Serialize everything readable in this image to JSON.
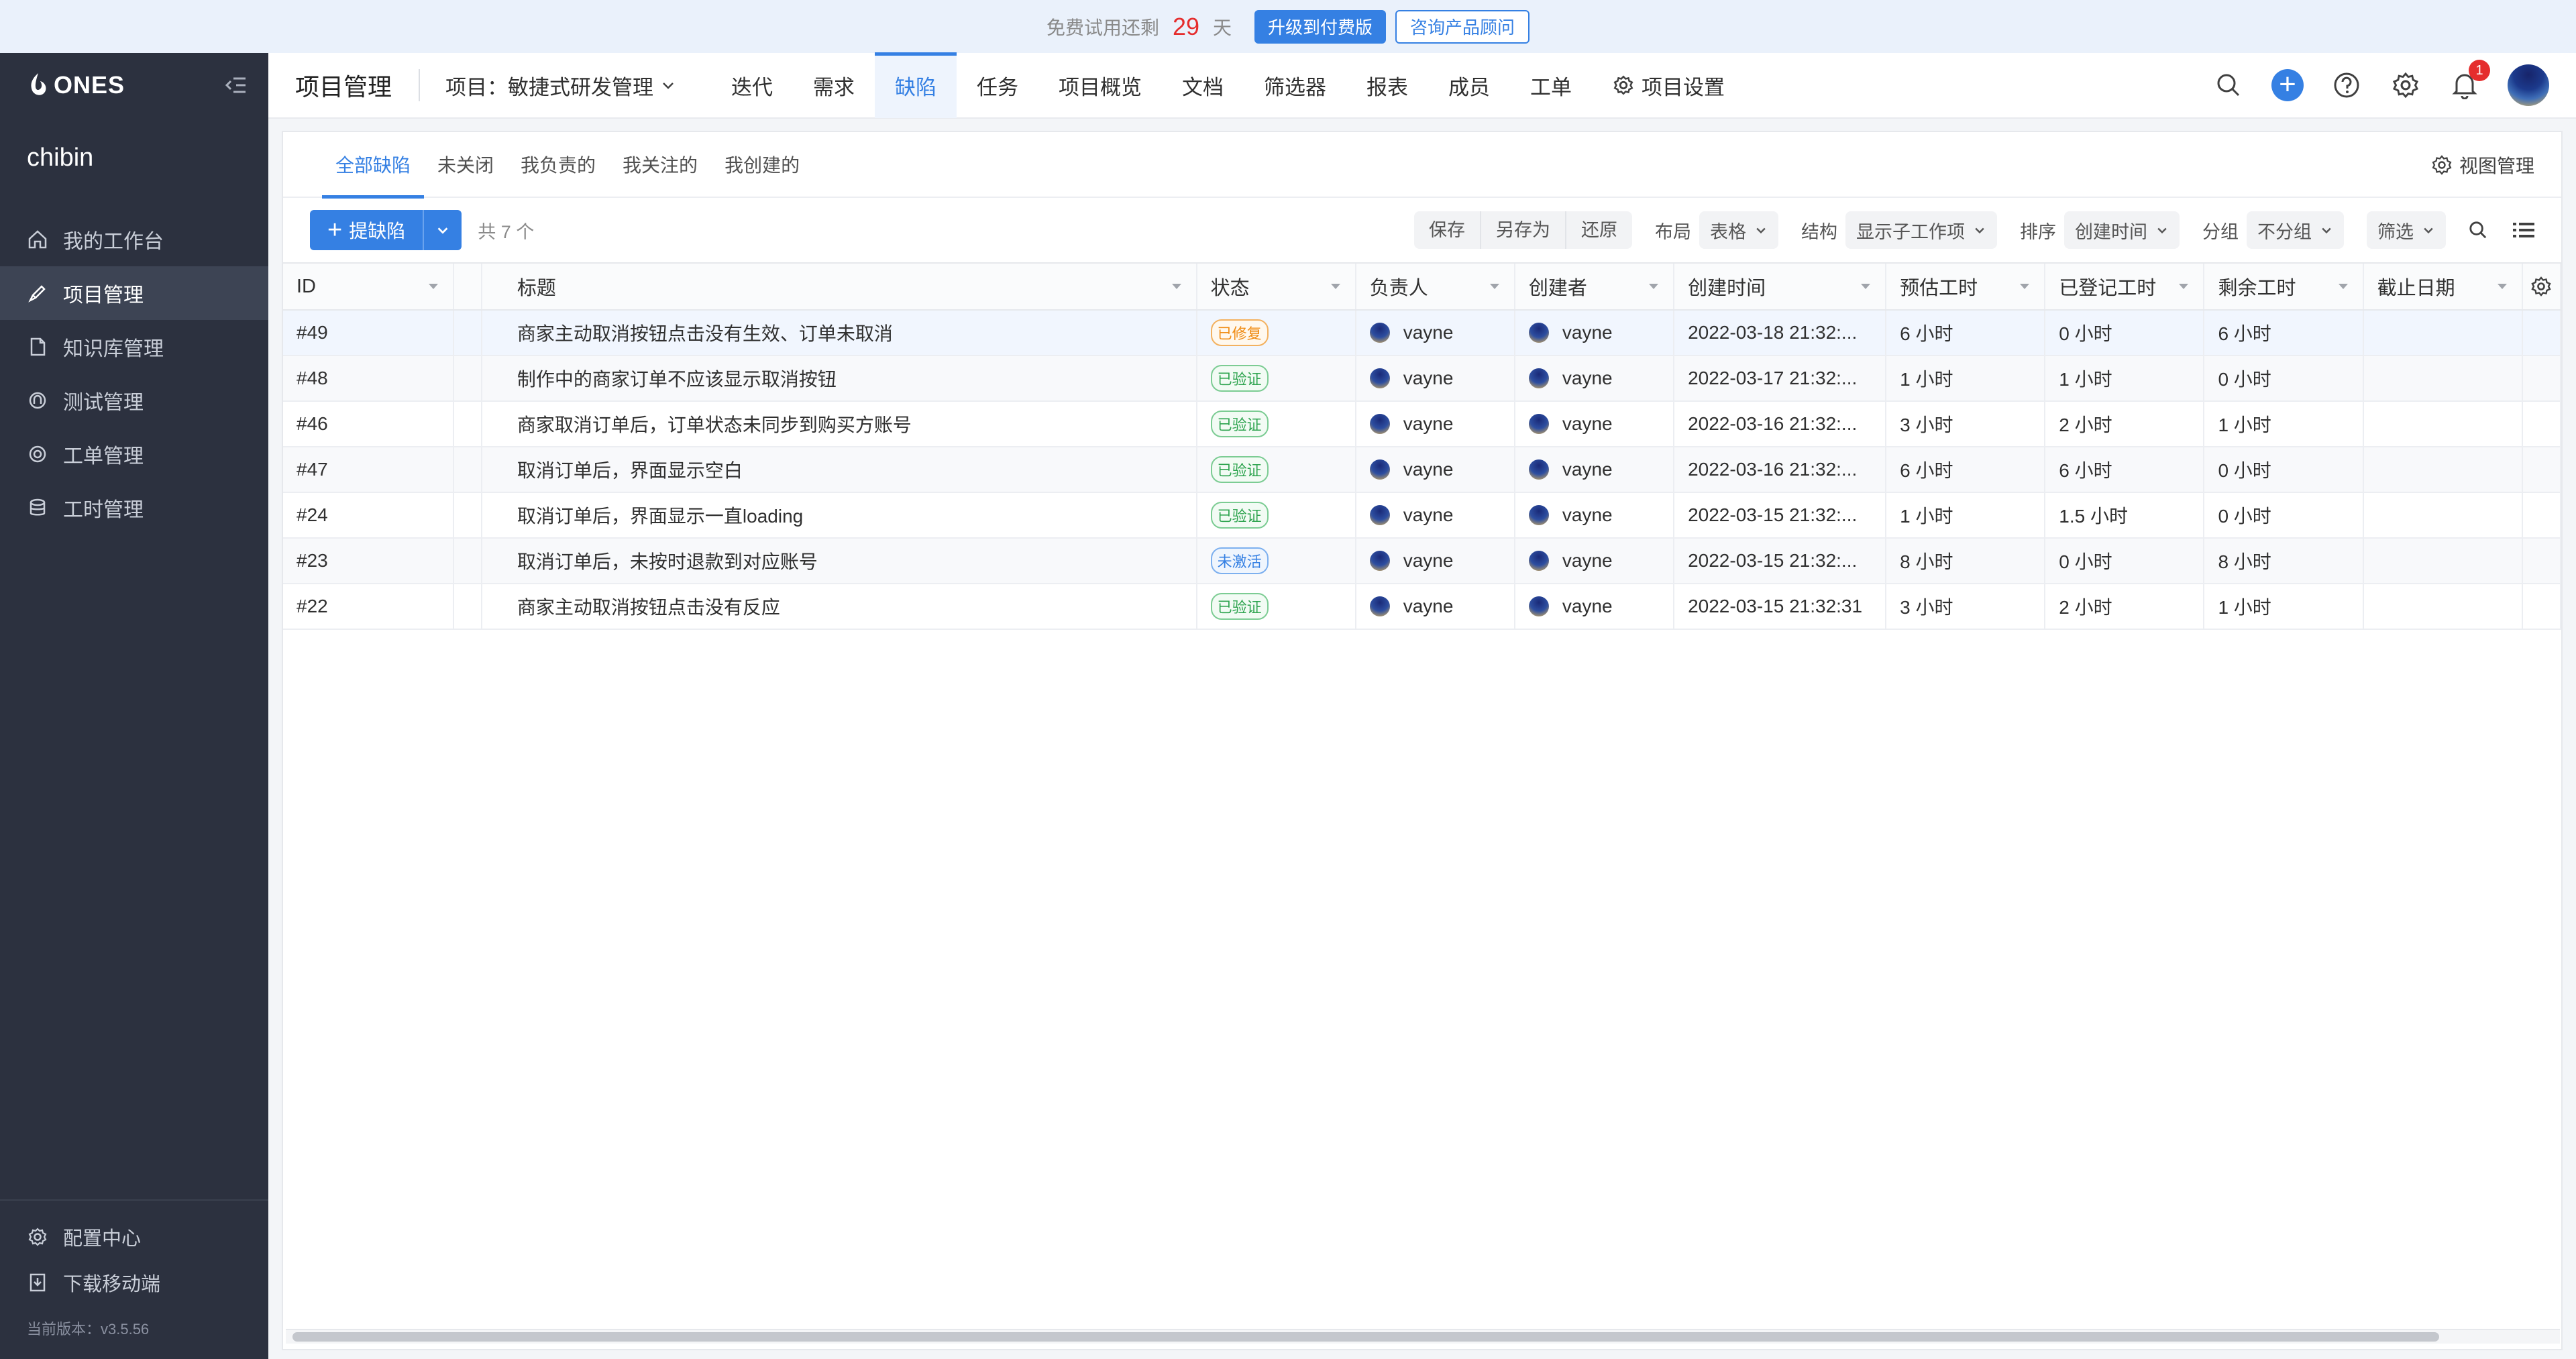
{
  "banner": {
    "prefix": "免费试用还剩",
    "days": "29",
    "suffix": "天",
    "upgrade_label": "升级到付费版",
    "consult_label": "咨询产品顾问"
  },
  "sidebar": {
    "logo_text": "ONES",
    "org_name": "chibin",
    "items": [
      {
        "label": "我的工作台",
        "icon": "home-icon"
      },
      {
        "label": "项目管理",
        "icon": "project-icon",
        "active": true
      },
      {
        "label": "知识库管理",
        "icon": "wiki-icon"
      },
      {
        "label": "测试管理",
        "icon": "test-icon"
      },
      {
        "label": "工单管理",
        "icon": "ticket-icon"
      },
      {
        "label": "工时管理",
        "icon": "timesheet-icon"
      }
    ],
    "bottom": [
      {
        "label": "配置中心",
        "icon": "gear-icon"
      },
      {
        "label": "下载移动端",
        "icon": "download-icon"
      }
    ],
    "version": "当前版本：v3.5.56"
  },
  "topnav": {
    "title": "项目管理",
    "project": "项目：敏捷式研发管理",
    "tabs": [
      "迭代",
      "需求",
      "缺陷",
      "任务",
      "项目概览",
      "文档",
      "筛选器",
      "报表",
      "成员",
      "工单",
      "项目设置"
    ],
    "active_tab": "缺陷",
    "notification_count": "1"
  },
  "subtabs": {
    "items": [
      "全部缺陷",
      "未关闭",
      "我负责的",
      "我关注的",
      "我创建的"
    ],
    "active": "全部缺陷",
    "view_manage": "视图管理"
  },
  "toolbar": {
    "add_label": "提缺陷",
    "count": "共 7 个",
    "save": "保存",
    "save_as": "另存为",
    "restore": "还原",
    "layout_label": "布局",
    "layout_value": "表格",
    "structure_label": "结构",
    "structure_value": "显示子工作项",
    "sort_label": "排序",
    "sort_value": "创建时间",
    "group_label": "分组",
    "group_value": "不分组",
    "filter_label": "筛选"
  },
  "table": {
    "columns": [
      "ID",
      "标题",
      "状态",
      "负责人",
      "创建者",
      "创建时间",
      "预估工时",
      "已登记工时",
      "剩余工时",
      "截止日期"
    ],
    "rows": [
      {
        "id": "#49",
        "title": "商家主动取消按钮点击没有生效、订单未取消",
        "status": "已修复",
        "status_type": "fixed",
        "owner": "vayne",
        "creator": "vayne",
        "created": "2022-03-18 21:32:...",
        "estimate": "6 小时",
        "recorded": "0 小时",
        "remaining": "6 小时",
        "due": ""
      },
      {
        "id": "#48",
        "title": "制作中的商家订单不应该显示取消按钮",
        "status": "已验证",
        "status_type": "verified",
        "owner": "vayne",
        "creator": "vayne",
        "created": "2022-03-17 21:32:...",
        "estimate": "1 小时",
        "recorded": "1 小时",
        "remaining": "0 小时",
        "due": ""
      },
      {
        "id": "#46",
        "title": "商家取消订单后，订单状态未同步到购买方账号",
        "status": "已验证",
        "status_type": "verified",
        "owner": "vayne",
        "creator": "vayne",
        "created": "2022-03-16 21:32:...",
        "estimate": "3 小时",
        "recorded": "2 小时",
        "remaining": "1 小时",
        "due": ""
      },
      {
        "id": "#47",
        "title": "取消订单后，界面显示空白",
        "status": "已验证",
        "status_type": "verified",
        "owner": "vayne",
        "creator": "vayne",
        "created": "2022-03-16 21:32:...",
        "estimate": "6 小时",
        "recorded": "6 小时",
        "remaining": "0 小时",
        "due": ""
      },
      {
        "id": "#24",
        "title": "取消订单后，界面显示一直loading",
        "status": "已验证",
        "status_type": "verified",
        "owner": "vayne",
        "creator": "vayne",
        "created": "2022-03-15 21:32:...",
        "estimate": "1 小时",
        "recorded": "1.5 小时",
        "remaining": "0 小时",
        "due": ""
      },
      {
        "id": "#23",
        "title": "取消订单后，未按时退款到对应账号",
        "status": "未激活",
        "status_type": "inactive",
        "owner": "vayne",
        "creator": "vayne",
        "created": "2022-03-15 21:32:...",
        "estimate": "8 小时",
        "recorded": "0 小时",
        "remaining": "8 小时",
        "due": ""
      },
      {
        "id": "#22",
        "title": "商家主动取消按钮点击没有反应",
        "status": "已验证",
        "status_type": "verified",
        "owner": "vayne",
        "creator": "vayne",
        "created": "2022-03-15 21:32:31",
        "estimate": "3 小时",
        "recorded": "2 小时",
        "remaining": "1 小时",
        "due": ""
      }
    ]
  },
  "colors": {
    "accent": "#3580e3",
    "sidebar_bg": "#2c313f",
    "fixed": "#f08c14",
    "verified": "#2ea44f",
    "inactive": "#3580e3",
    "badge": "#e52d2d"
  }
}
